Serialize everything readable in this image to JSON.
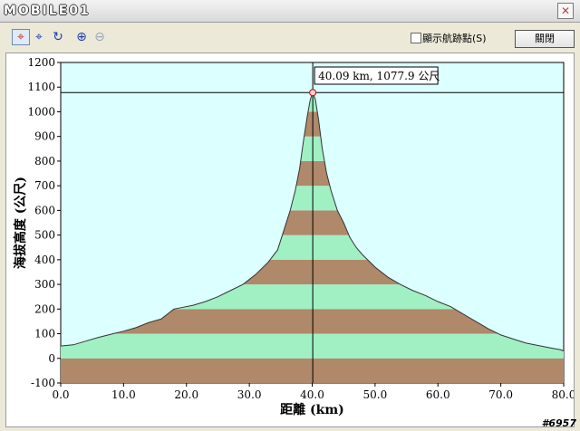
{
  "window": {
    "logo_text": "MOBILE01",
    "close_glyph": "✕"
  },
  "toolbar": {
    "tools": [
      {
        "name": "crosshair-red-icon",
        "glyph": "⌖",
        "color": "#c0392b"
      },
      {
        "name": "crosshair-blue-icon",
        "glyph": "⌖",
        "color": "#1f3fa8"
      },
      {
        "name": "hand-rotate-icon",
        "glyph": "↻",
        "color": "#1f3fa8"
      },
      {
        "name": "zoom-in-icon",
        "glyph": "⊕",
        "color": "#1f3fa8"
      },
      {
        "name": "zoom-out-icon",
        "glyph": "⊖",
        "color": "#9aa4b8"
      }
    ],
    "show_waypoints_label": "顯示航跡點(S)",
    "show_waypoints_checked": false,
    "open_button_label": "關閉"
  },
  "chart_data": {
    "type": "area",
    "xlabel": "距離 (km)",
    "ylabel": "海拔高度 (公尺)",
    "xlim": [
      0,
      80
    ],
    "ylim": [
      -100,
      1200
    ],
    "xticks": [
      "0.0",
      "10.0",
      "20.0",
      "30.0",
      "40.0",
      "50.0",
      "60.0",
      "70.0",
      "80.0"
    ],
    "yticks": [
      "-100",
      "0",
      "100",
      "200",
      "300",
      "400",
      "500",
      "600",
      "700",
      "800",
      "900",
      "1000",
      "1100",
      "1200"
    ],
    "band_colors": [
      "#b0886a",
      "#a0f0c4"
    ],
    "plot_background": "#dcffff",
    "profile": [
      [
        0.0,
        50
      ],
      [
        2.0,
        55
      ],
      [
        4.0,
        70
      ],
      [
        6.0,
        85
      ],
      [
        8.0,
        98
      ],
      [
        10.0,
        110
      ],
      [
        12.0,
        125
      ],
      [
        14.0,
        145
      ],
      [
        16.0,
        160
      ],
      [
        17.0,
        180
      ],
      [
        18.0,
        200
      ],
      [
        19.0,
        205
      ],
      [
        21.0,
        215
      ],
      [
        23.0,
        230
      ],
      [
        25.0,
        250
      ],
      [
        27.0,
        275
      ],
      [
        29.0,
        300
      ],
      [
        31.0,
        340
      ],
      [
        33.0,
        390
      ],
      [
        34.5,
        440
      ],
      [
        35.5,
        520
      ],
      [
        36.5,
        600
      ],
      [
        37.3,
        680
      ],
      [
        38.0,
        770
      ],
      [
        38.6,
        880
      ],
      [
        39.2,
        980
      ],
      [
        39.7,
        1050
      ],
      [
        40.09,
        1077.9
      ],
      [
        40.5,
        1050
      ],
      [
        41.0,
        970
      ],
      [
        41.6,
        850
      ],
      [
        42.3,
        750
      ],
      [
        43.0,
        680
      ],
      [
        44.0,
        600
      ],
      [
        45.0,
        550
      ],
      [
        46.0,
        490
      ],
      [
        47.0,
        450
      ],
      [
        48.0,
        420
      ],
      [
        50.0,
        370
      ],
      [
        52.0,
        330
      ],
      [
        54.0,
        300
      ],
      [
        56.0,
        275
      ],
      [
        58.0,
        255
      ],
      [
        60.0,
        230
      ],
      [
        62.0,
        210
      ],
      [
        64.0,
        180
      ],
      [
        66.0,
        150
      ],
      [
        68.0,
        120
      ],
      [
        70.0,
        95
      ],
      [
        72.0,
        78
      ],
      [
        74.0,
        62
      ],
      [
        76.0,
        52
      ],
      [
        78.0,
        42
      ],
      [
        79.5,
        35
      ],
      [
        80.0,
        30
      ]
    ],
    "cursor": {
      "x": 40.09,
      "y": 1077.9,
      "label": "40.09 km, 1077.9 公尺"
    }
  },
  "watermark": "#6957"
}
